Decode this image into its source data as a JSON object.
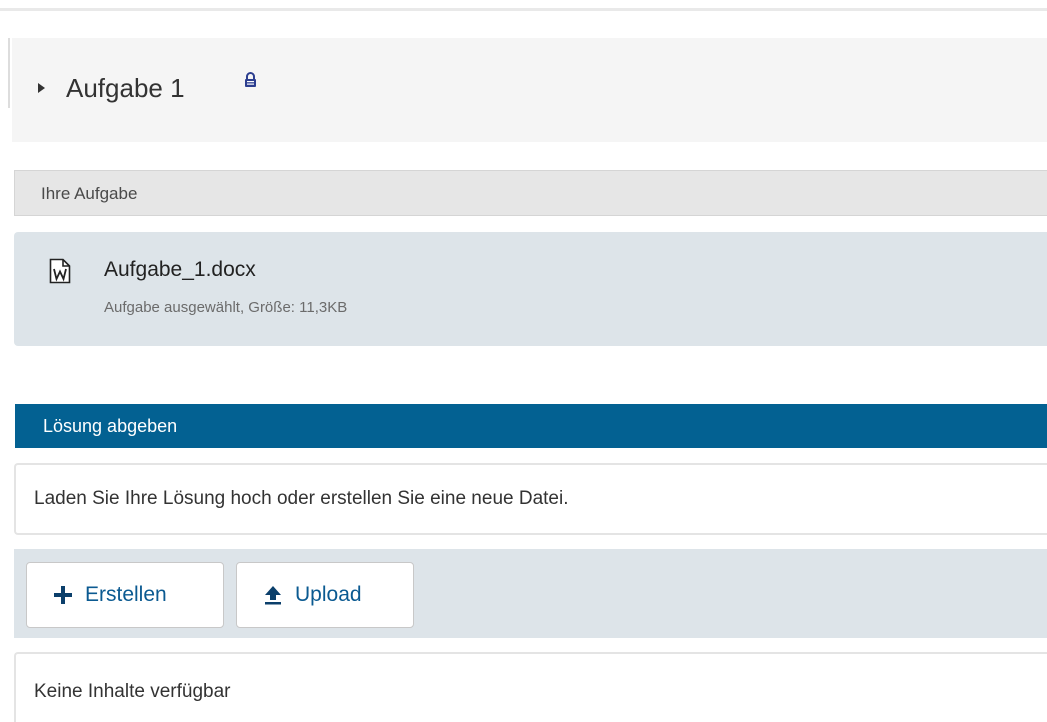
{
  "task": {
    "title": "Aufgabe 1",
    "expand_icon": "caret-right-icon",
    "lock_icon": "lock-icon"
  },
  "your_task": {
    "heading": "Ihre Aufgabe",
    "file": {
      "icon": "word-document-icon",
      "name": "Aufgabe_1.docx",
      "meta": "Aufgabe ausgewählt, Größe: 11,3KB"
    }
  },
  "submit": {
    "heading": "Lösung abgeben",
    "instruction": "Laden Sie Ihre Lösung hoch oder erstellen Sie eine neue Datei.",
    "buttons": {
      "create_label": "Erstellen",
      "create_icon": "plus-icon",
      "upload_label": "Upload",
      "upload_icon": "upload-icon"
    },
    "empty_text": "Keine Inhalte verfügbar"
  },
  "colors": {
    "section_blue": "#036192",
    "link_blue": "#0b5a91",
    "panel_grey": "#dde4e9"
  }
}
